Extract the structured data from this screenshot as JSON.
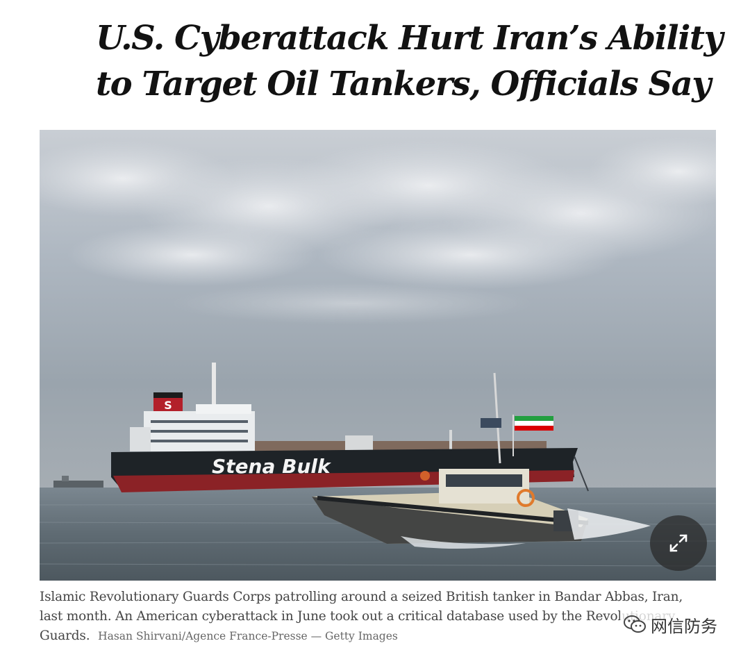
{
  "article": {
    "headline_line1": "U.S. Cyberattack Hurt Iran’s Ability",
    "headline_line2": "to Target Oil Tankers, Officials Say"
  },
  "photo": {
    "tanker_name": "Stena Bulk",
    "tanker_logo_letter": "S",
    "expand_icon": "expand-arrows-icon"
  },
  "caption": {
    "text": "Islamic Revolutionary Guards Corps patrolling around a seized British tanker in Bandar Abbas, Iran, last month. An American cyberattack in June took out a critical database used by the Revolutionary Guards.",
    "credit": "Hasan Shirvani/Agence France-Presse — Getty Images"
  },
  "watermark": {
    "text": "网信防务",
    "icon": "wechat-icon"
  }
}
